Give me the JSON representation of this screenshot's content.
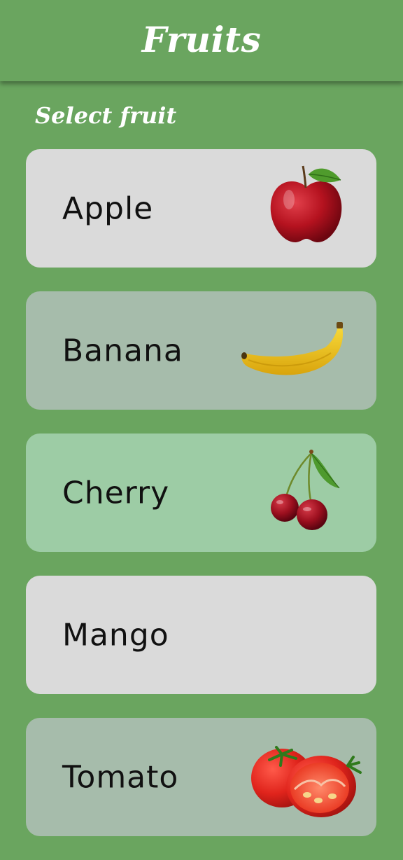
{
  "app": {
    "title": "Fruits"
  },
  "subtitle": "Select fruit",
  "fruits": [
    {
      "label": "Apple",
      "icon": "apple-icon",
      "color": "#dadada"
    },
    {
      "label": "Banana",
      "icon": "banana-icon",
      "color": "#a6bcab"
    },
    {
      "label": "Cherry",
      "icon": "cherry-icon",
      "color": "#9dcca5"
    },
    {
      "label": "Mango",
      "icon": "",
      "color": "#dadada"
    },
    {
      "label": "Tomato",
      "icon": "tomato-icon",
      "color": "#a6bcab"
    }
  ],
  "colors": {
    "background": "#6aa55f",
    "appbar": "#6aa55f",
    "text": "#ffffff"
  }
}
